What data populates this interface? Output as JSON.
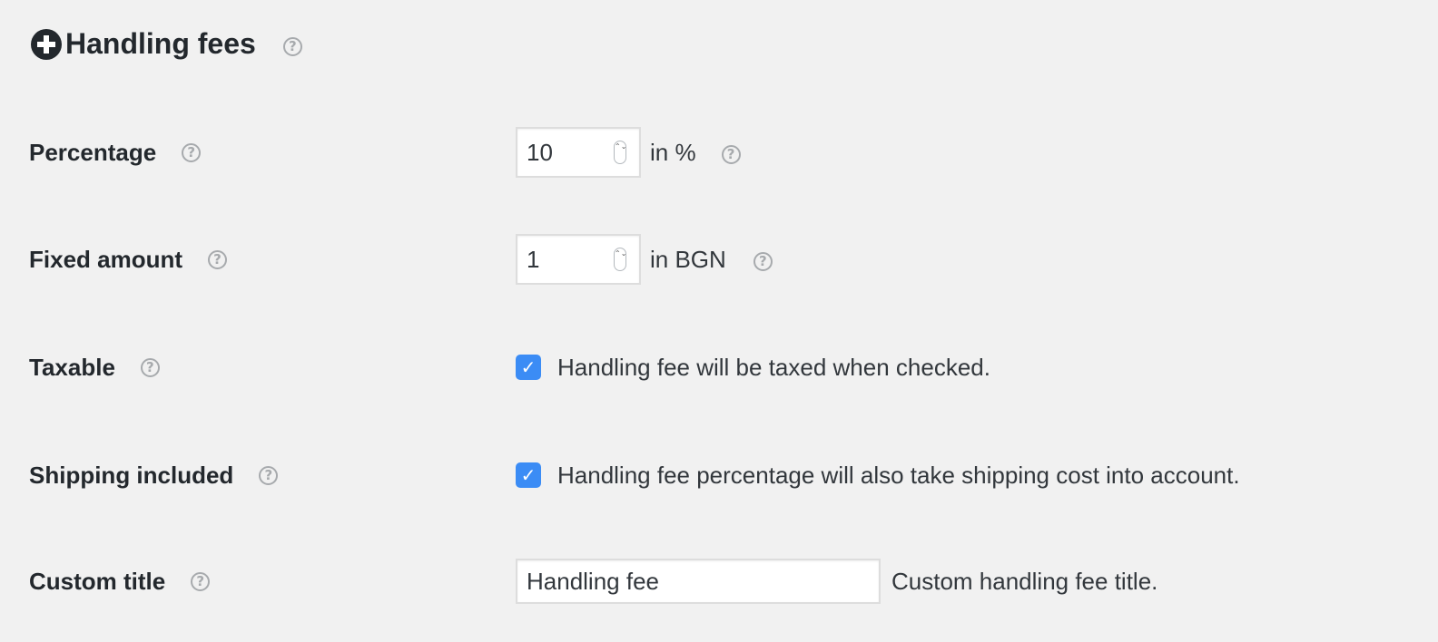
{
  "section": {
    "title": "Handling fees",
    "help_glyph": "?"
  },
  "rows": {
    "percentage": {
      "label": "Percentage",
      "value": "10",
      "unit": "in %",
      "help_glyph": "?"
    },
    "fixed_amount": {
      "label": "Fixed amount",
      "value": "1",
      "unit": "in BGN",
      "help_glyph": "?"
    },
    "taxable": {
      "label": "Taxable",
      "checked": true,
      "description": "Handling fee will be taxed when checked.",
      "help_glyph": "?"
    },
    "shipping_included": {
      "label": "Shipping included",
      "checked": true,
      "description": "Handling fee percentage will also take shipping cost into account.",
      "help_glyph": "?"
    },
    "custom_title": {
      "label": "Custom title",
      "value": "Handling fee",
      "description": "Custom handling fee title.",
      "help_glyph": "?"
    }
  },
  "icons": {
    "section_expand": "plus-circle-icon",
    "help": "question-circle-icon",
    "check": "checkmark-icon",
    "spinner": "stepper-arrows-icon",
    "check_glyph": "✓",
    "spinner_glyph": "⌃⌄"
  },
  "colors": {
    "background": "#f1f1f1",
    "text": "#23282d",
    "help_icon": "#a7aaad",
    "checkbox": "#3b8cf5",
    "input_border": "#dddddd"
  }
}
